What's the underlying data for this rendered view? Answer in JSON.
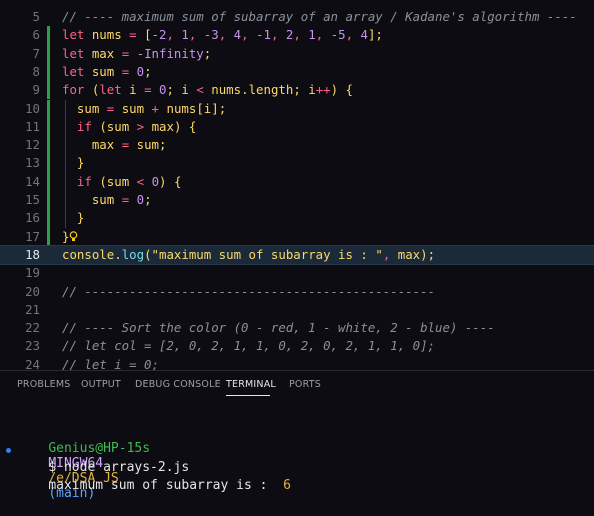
{
  "editor": {
    "lines": [
      {
        "n": "5",
        "tokens": [
          {
            "t": "// ---- maximum sum of subarray of an array / Kadane's algorithm ----",
            "c": "comment"
          }
        ]
      },
      {
        "n": "6",
        "tokens": [
          {
            "t": "let ",
            "c": "kw"
          },
          {
            "t": "nums",
            "c": "var"
          },
          {
            "t": " = ",
            "c": "op"
          },
          {
            "t": "[",
            "c": "plain"
          },
          {
            "t": "-2",
            "c": "num"
          },
          {
            "t": ", ",
            "c": "punc"
          },
          {
            "t": "1",
            "c": "num"
          },
          {
            "t": ", ",
            "c": "punc"
          },
          {
            "t": "-3",
            "c": "num"
          },
          {
            "t": ", ",
            "c": "punc"
          },
          {
            "t": "4",
            "c": "num"
          },
          {
            "t": ", ",
            "c": "punc"
          },
          {
            "t": "-1",
            "c": "num"
          },
          {
            "t": ", ",
            "c": "punc"
          },
          {
            "t": "2",
            "c": "num"
          },
          {
            "t": ", ",
            "c": "punc"
          },
          {
            "t": "1",
            "c": "num"
          },
          {
            "t": ", ",
            "c": "punc"
          },
          {
            "t": "-5",
            "c": "num"
          },
          {
            "t": ", ",
            "c": "punc"
          },
          {
            "t": "4",
            "c": "num"
          },
          {
            "t": "];",
            "c": "plain"
          }
        ]
      },
      {
        "n": "7",
        "tokens": [
          {
            "t": "let ",
            "c": "kw"
          },
          {
            "t": "max",
            "c": "var"
          },
          {
            "t": " = ",
            "c": "op"
          },
          {
            "t": "-Infinity",
            "c": "num"
          },
          {
            "t": ";",
            "c": "plain"
          }
        ]
      },
      {
        "n": "8",
        "tokens": [
          {
            "t": "let ",
            "c": "kw"
          },
          {
            "t": "sum",
            "c": "var"
          },
          {
            "t": " = ",
            "c": "op"
          },
          {
            "t": "0",
            "c": "num"
          },
          {
            "t": ";",
            "c": "plain"
          }
        ]
      },
      {
        "n": "9",
        "tokens": [
          {
            "t": "for ",
            "c": "kw"
          },
          {
            "t": "(",
            "c": "plain"
          },
          {
            "t": "let ",
            "c": "kw"
          },
          {
            "t": "i",
            "c": "var"
          },
          {
            "t": " = ",
            "c": "op"
          },
          {
            "t": "0",
            "c": "num"
          },
          {
            "t": "; ",
            "c": "plain"
          },
          {
            "t": "i",
            "c": "var"
          },
          {
            "t": " < ",
            "c": "op"
          },
          {
            "t": "nums",
            "c": "var"
          },
          {
            "t": ".length; ",
            "c": "plain"
          },
          {
            "t": "i",
            "c": "var"
          },
          {
            "t": "++",
            "c": "op"
          },
          {
            "t": ") {",
            "c": "plain"
          }
        ]
      },
      {
        "n": "10",
        "tokens": [
          {
            "t": "  ",
            "c": "id"
          },
          {
            "t": "sum",
            "c": "var"
          },
          {
            "t": " = ",
            "c": "op"
          },
          {
            "t": "sum",
            "c": "var"
          },
          {
            "t": " + ",
            "c": "op"
          },
          {
            "t": "nums",
            "c": "var"
          },
          {
            "t": "[",
            "c": "plain"
          },
          {
            "t": "i",
            "c": "var"
          },
          {
            "t": "];",
            "c": "plain"
          }
        ]
      },
      {
        "n": "11",
        "tokens": [
          {
            "t": "  ",
            "c": "id"
          },
          {
            "t": "if ",
            "c": "kw"
          },
          {
            "t": "(",
            "c": "plain"
          },
          {
            "t": "sum",
            "c": "var"
          },
          {
            "t": " > ",
            "c": "op"
          },
          {
            "t": "max",
            "c": "var"
          },
          {
            "t": ") {",
            "c": "plain"
          }
        ]
      },
      {
        "n": "12",
        "tokens": [
          {
            "t": "    ",
            "c": "id"
          },
          {
            "t": "max",
            "c": "var"
          },
          {
            "t": " = ",
            "c": "op"
          },
          {
            "t": "sum",
            "c": "var"
          },
          {
            "t": ";",
            "c": "plain"
          }
        ]
      },
      {
        "n": "13",
        "tokens": [
          {
            "t": "  ",
            "c": "id"
          },
          {
            "t": "}",
            "c": "plain"
          }
        ]
      },
      {
        "n": "14",
        "tokens": [
          {
            "t": "  ",
            "c": "id"
          },
          {
            "t": "if ",
            "c": "kw"
          },
          {
            "t": "(",
            "c": "plain"
          },
          {
            "t": "sum",
            "c": "var"
          },
          {
            "t": " < ",
            "c": "op"
          },
          {
            "t": "0",
            "c": "num"
          },
          {
            "t": ") {",
            "c": "plain"
          }
        ]
      },
      {
        "n": "15",
        "tokens": [
          {
            "t": "    ",
            "c": "id"
          },
          {
            "t": "sum",
            "c": "var"
          },
          {
            "t": " = ",
            "c": "op"
          },
          {
            "t": "0",
            "c": "num"
          },
          {
            "t": ";",
            "c": "plain"
          }
        ]
      },
      {
        "n": "16",
        "tokens": [
          {
            "t": "  ",
            "c": "id"
          },
          {
            "t": "}",
            "c": "plain"
          }
        ]
      },
      {
        "n": "17",
        "tokens": [
          {
            "t": "}",
            "c": "plain"
          }
        ],
        "bulb": true
      },
      {
        "n": "18",
        "active": true,
        "tokens": [
          {
            "t": "console",
            "c": "var"
          },
          {
            "t": ".",
            "c": "plain"
          },
          {
            "t": "log",
            "c": "fn"
          },
          {
            "t": "(",
            "c": "plain"
          },
          {
            "t": "\"maximum sum of subarray is : \"",
            "c": "str"
          },
          {
            "t": ", ",
            "c": "punc"
          },
          {
            "t": "max",
            "c": "var"
          },
          {
            "t": ");",
            "c": "plain"
          }
        ]
      },
      {
        "n": "19",
        "tokens": []
      },
      {
        "n": "20",
        "tokens": [
          {
            "t": "// -----------------------------------------------",
            "c": "comment"
          }
        ]
      },
      {
        "n": "21",
        "tokens": []
      },
      {
        "n": "22",
        "tokens": [
          {
            "t": "// ---- Sort the color (0 - red, 1 - white, 2 - blue) ----",
            "c": "comment"
          }
        ]
      },
      {
        "n": "23",
        "tokens": [
          {
            "t": "// let col = [2, 0, 2, 1, 1, 0, 2, 0, 2, 1, 1, 0];",
            "c": "comment"
          }
        ]
      },
      {
        "n": "24",
        "tokens": [
          {
            "t": "// let i = 0;",
            "c": "comment"
          }
        ]
      }
    ],
    "bulb_icon": "lightbulb-icon"
  },
  "panel": {
    "tabs": [
      {
        "label": "PROBLEMS",
        "active": false
      },
      {
        "label": "OUTPUT",
        "active": false
      },
      {
        "label": "DEBUG CONSOLE",
        "active": false
      },
      {
        "label": "TERMINAL",
        "active": true
      },
      {
        "label": "PORTS",
        "active": false
      }
    ],
    "terminal": {
      "prompt_user": "Genius@HP-15s",
      "prompt_host": "MINGW64",
      "prompt_path": "/e/DSA JS",
      "prompt_branch": "(main)",
      "command": "$ node arrays-2.js",
      "output_text": "maximum sum of subarray is :  ",
      "output_value": "6"
    }
  }
}
